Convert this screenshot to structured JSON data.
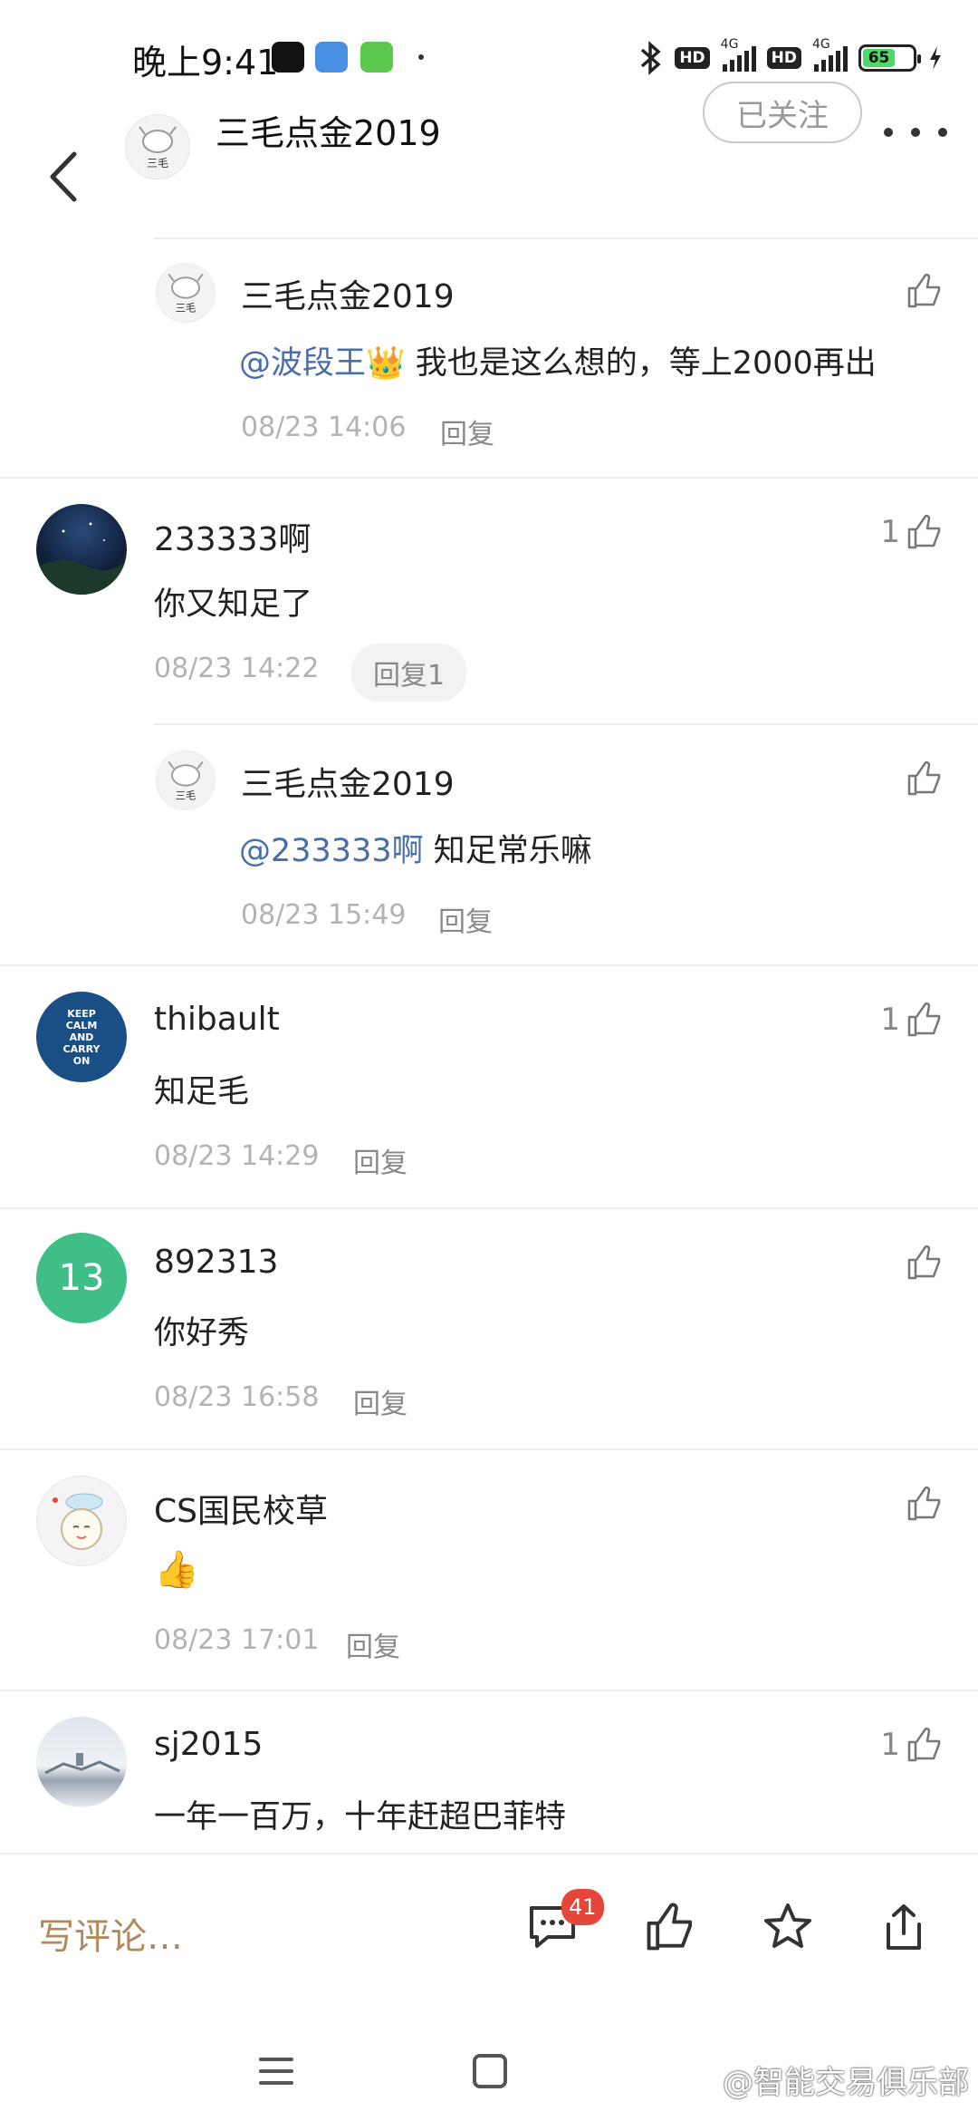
{
  "status_bar": {
    "time": "晚上9:41",
    "net1": "4G",
    "net2": "4G",
    "hd": "HD",
    "battery": "65"
  },
  "header": {
    "title": "三毛点金2019",
    "follow_label": "已关注"
  },
  "comments": [
    {
      "kind": "reply",
      "name": "三毛点金2019",
      "mention": "@波段王👑",
      "text": " 我也是这么想的，等上2000再出",
      "time": "08/23 14:06",
      "reply_label": "回复",
      "likes": ""
    },
    {
      "kind": "top",
      "name": "233333啊",
      "text": "你又知足了",
      "time": "08/23 14:22",
      "reply_label": "回复1",
      "likes": "1"
    },
    {
      "kind": "reply",
      "name": "三毛点金2019",
      "mention": "@233333啊",
      "text": " 知足常乐嘛",
      "time": "08/23 15:49",
      "reply_label": "回复",
      "likes": ""
    },
    {
      "kind": "top",
      "name": "thibault",
      "text": "知足毛",
      "time": "08/23 14:29",
      "reply_label": "回复",
      "likes": "1",
      "avatar_text": "KEEP CALM AND CARRY ON"
    },
    {
      "kind": "top",
      "name": "892313",
      "text": "你好秀",
      "time": "08/23 16:58",
      "reply_label": "回复",
      "likes": "",
      "avatar_text": "13"
    },
    {
      "kind": "top",
      "name": "CS国民校草",
      "text": "👍",
      "time": "08/23 17:01",
      "reply_label": "回复",
      "likes": ""
    },
    {
      "kind": "top",
      "name": "sj2015",
      "text": "一年一百万，十年赶超巴菲特",
      "likes": "1"
    }
  ],
  "bottom_bar": {
    "write_placeholder": "写评论…",
    "comment_count": "41"
  },
  "watermark": "@智能交易俱乐部",
  "avatar_logo": "三毛",
  "colors": {
    "mention": "#4a6ea8",
    "badge": "#e4463b",
    "write_comment": "#b08a5a",
    "avatar_green": "#3fbf87"
  }
}
